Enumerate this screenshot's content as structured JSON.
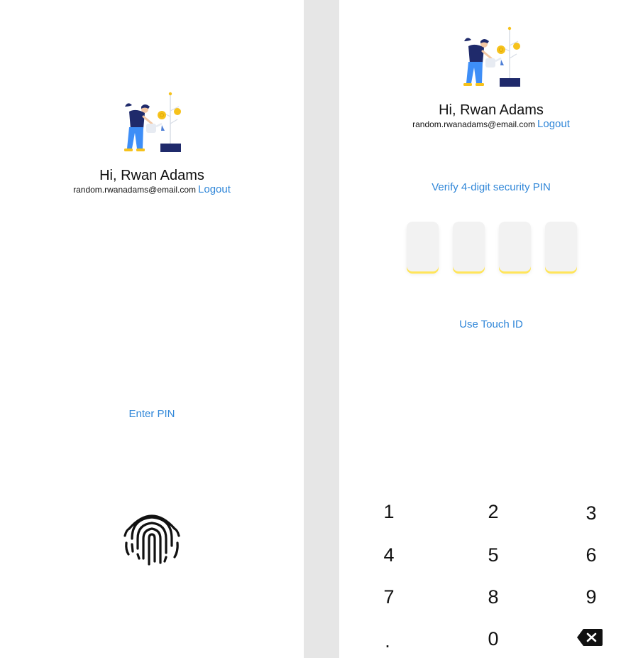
{
  "user": {
    "greeting": "Hi, Rwan Adams",
    "email": "random.rwanadams@email.com",
    "logout_label": "Logout"
  },
  "touch_screen": {
    "enter_pin_label": "Enter PIN",
    "fingerprint_icon": "fingerprint-icon"
  },
  "pin_screen": {
    "title": "Verify 4-digit security PIN",
    "use_touch_id_label": "Use Touch ID",
    "pin_values": [
      "",
      "",
      "",
      ""
    ],
    "keypad": [
      "1",
      "2",
      "3",
      "4",
      "5",
      "6",
      "7",
      "8",
      "9",
      ".",
      "0"
    ],
    "backspace_icon": "backspace-icon"
  },
  "colors": {
    "accent": "#2f86d8",
    "pin_underline": "#ffe55a",
    "pin_fill": "#f2f2f2",
    "divider": "#e6e6e6",
    "illustration_navy": "#1f2a6b",
    "illustration_blue": "#3e8ef7",
    "illustration_yellow": "#f6c21c"
  }
}
